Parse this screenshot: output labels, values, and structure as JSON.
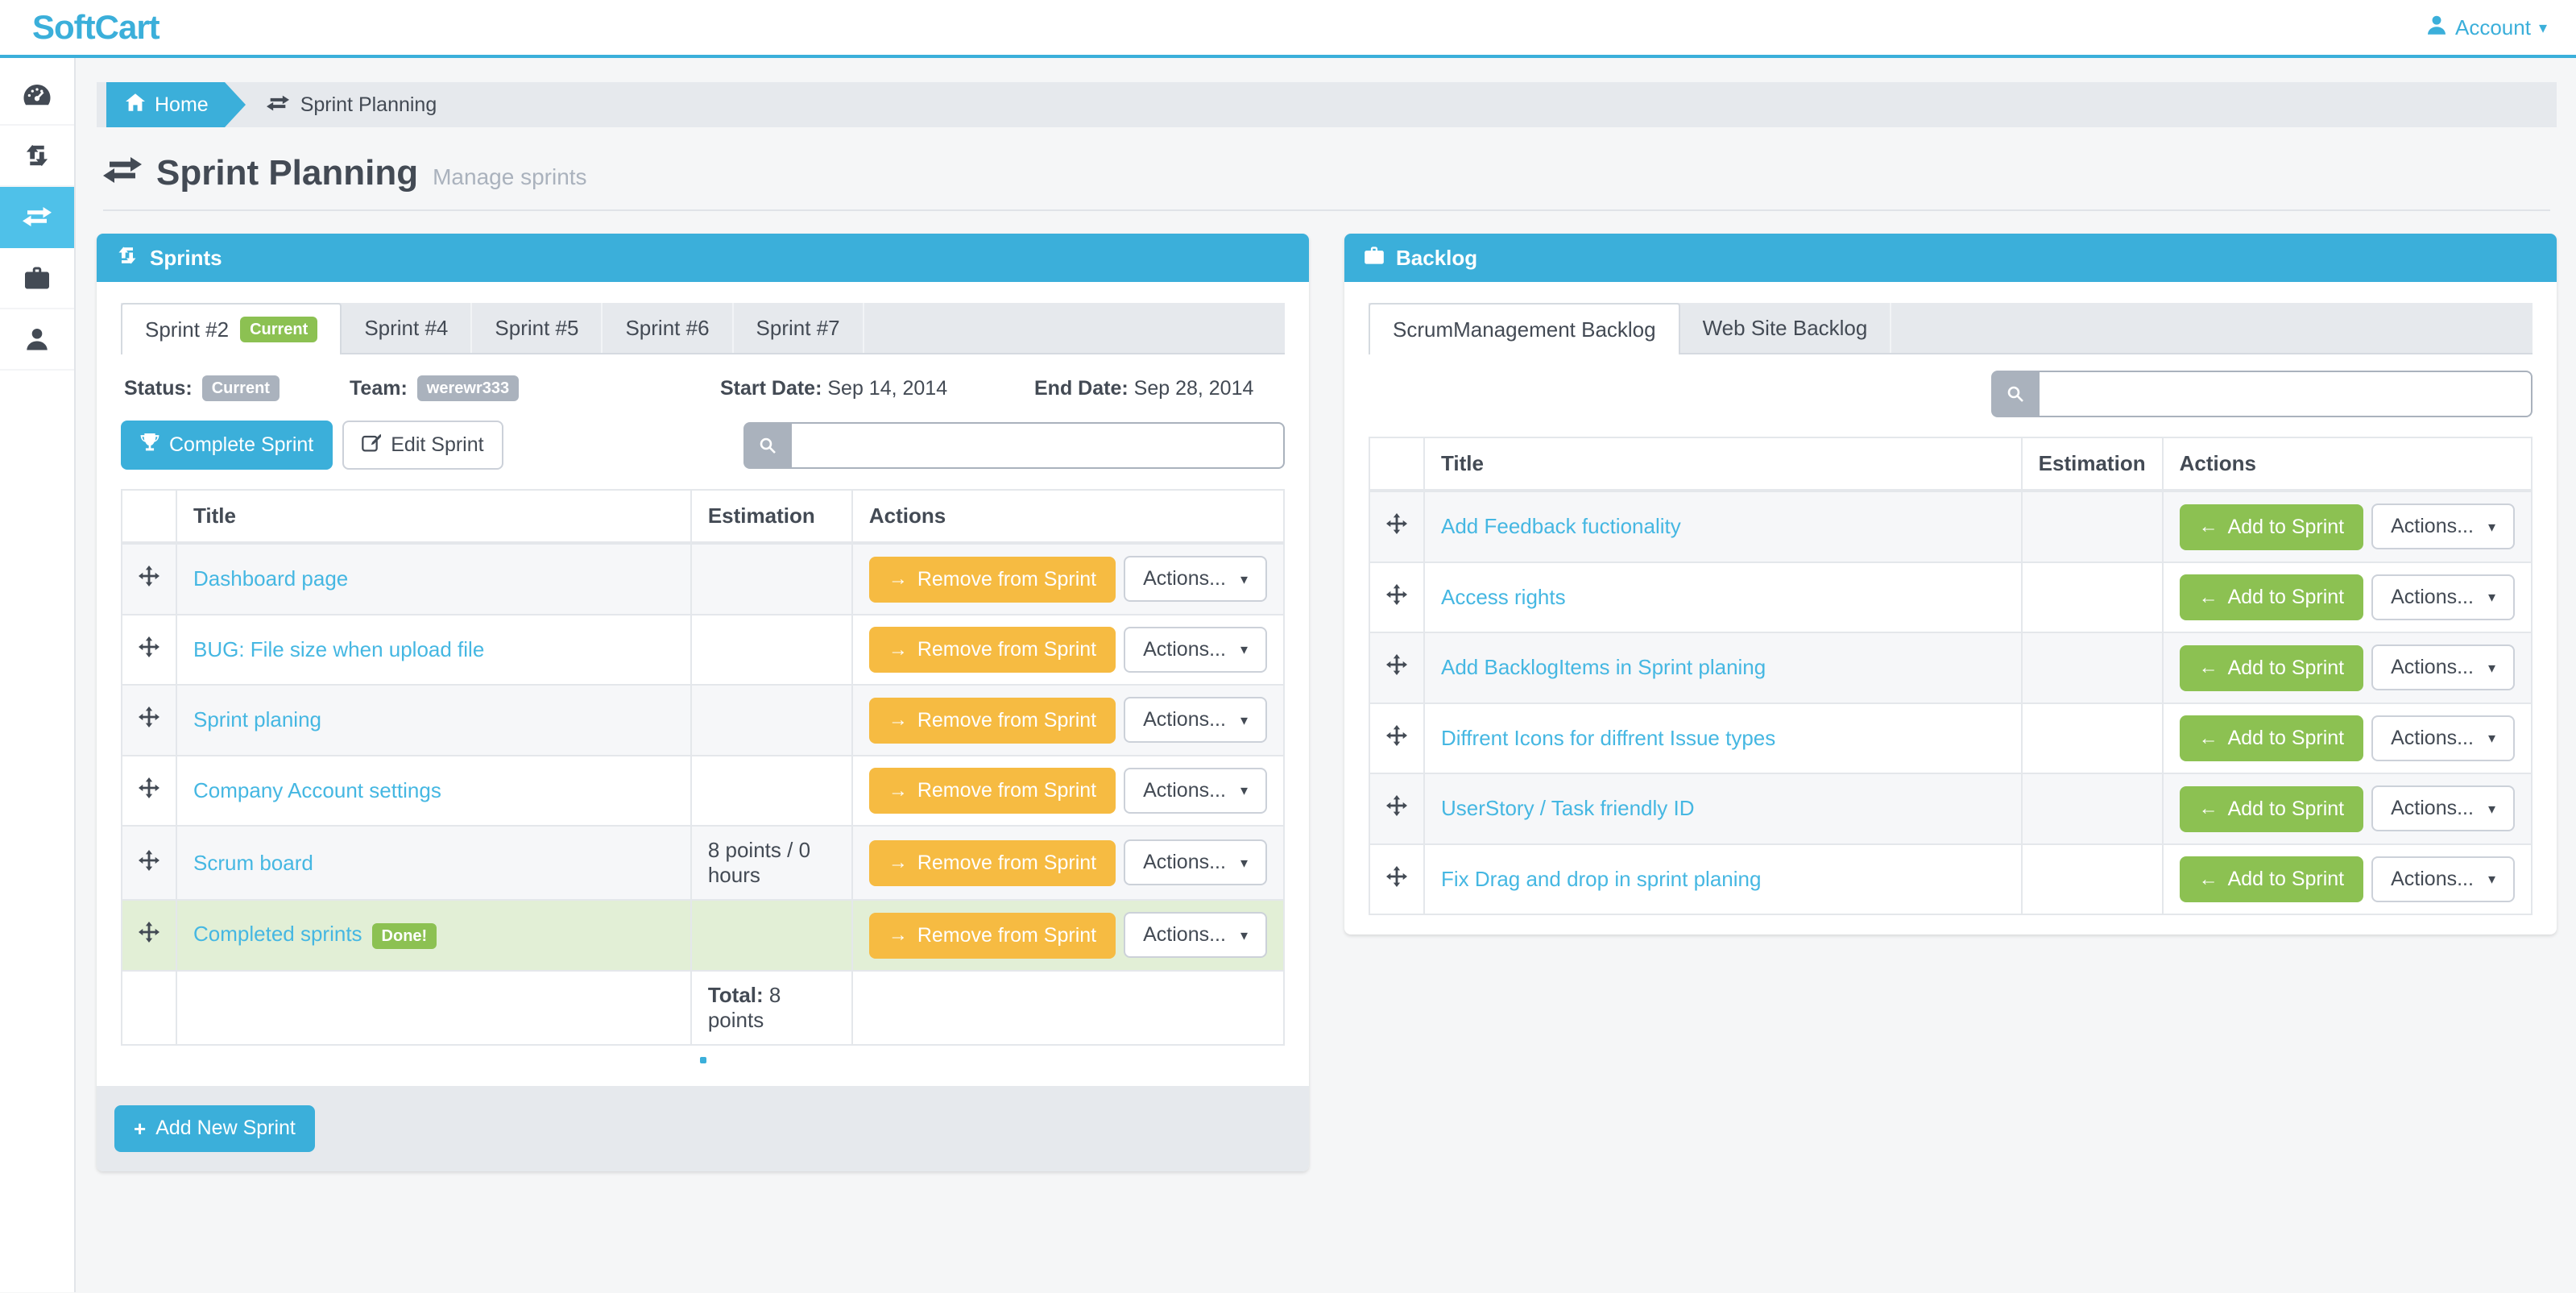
{
  "navbar": {
    "brand": "SoftCart",
    "account_label": "Account"
  },
  "sidebar": {
    "items": [
      {
        "id": "dashboard",
        "icon": "tachometer-icon",
        "active": false
      },
      {
        "id": "iterations",
        "icon": "retweet-icon",
        "active": false
      },
      {
        "id": "sprint-planning",
        "icon": "exchange-icon",
        "active": true
      },
      {
        "id": "backlog",
        "icon": "briefcase-icon",
        "active": false
      },
      {
        "id": "team",
        "icon": "user-icon",
        "active": false
      }
    ]
  },
  "breadcrumb": {
    "home": "Home",
    "current": "Sprint Planning"
  },
  "page": {
    "title": "Sprint Planning",
    "subtitle": "Manage sprints"
  },
  "sprints_panel": {
    "title": "Sprints",
    "tabs": [
      {
        "label": "Sprint #2",
        "badge": "Current",
        "active": true
      },
      {
        "label": "Sprint #4",
        "badge": null,
        "active": false
      },
      {
        "label": "Sprint #5",
        "badge": null,
        "active": false
      },
      {
        "label": "Sprint #6",
        "badge": null,
        "active": false
      },
      {
        "label": "Sprint #7",
        "badge": null,
        "active": false
      }
    ],
    "meta": {
      "status_label": "Status:",
      "status_value": "Current",
      "team_label": "Team:",
      "team_value": "werewr333",
      "start_label": "Start Date:",
      "start_value": "Sep 14, 2014",
      "end_label": "End Date:",
      "end_value": "Sep 28, 2014"
    },
    "buttons": {
      "complete": "Complete Sprint",
      "edit": "Edit Sprint"
    },
    "search_value": "",
    "table": {
      "columns": [
        "",
        "Title",
        "Estimation",
        "Actions"
      ],
      "remove_button": "Remove from Sprint",
      "actions_button": "Actions...",
      "rows": [
        {
          "title": "Dashboard page",
          "estimation": "",
          "badge": null,
          "done": false
        },
        {
          "title": "BUG: File size when upload file",
          "estimation": "",
          "badge": null,
          "done": false
        },
        {
          "title": "Sprint planing",
          "estimation": "",
          "badge": null,
          "done": false
        },
        {
          "title": "Company Account settings",
          "estimation": "",
          "badge": null,
          "done": false
        },
        {
          "title": "Scrum board",
          "estimation": "8 points / 0 hours",
          "badge": null,
          "done": false
        },
        {
          "title": "Completed sprints",
          "estimation": "",
          "badge": "Done!",
          "done": true
        }
      ],
      "total_label": "Total:",
      "total_value": "8 points"
    },
    "footer": {
      "add_button": "Add New Sprint"
    }
  },
  "backlog_panel": {
    "title": "Backlog",
    "tabs": [
      {
        "label": "ScrumManagement Backlog",
        "badge": null,
        "active": true
      },
      {
        "label": "Web Site Backlog",
        "badge": null,
        "active": false
      }
    ],
    "search_value": "",
    "table": {
      "columns": [
        "",
        "Title",
        "Estimation",
        "Actions"
      ],
      "add_button": "Add to Sprint",
      "actions_button": "Actions...",
      "rows": [
        {
          "title": "Add Feedback fuctionality"
        },
        {
          "title": "Access rights"
        },
        {
          "title": "Add BacklogItems in Sprint planing"
        },
        {
          "title": "Diffrent Icons for diffrent Issue types"
        },
        {
          "title": "UserStory / Task friendly ID"
        },
        {
          "title": "Fix Drag and drop in sprint planing"
        }
      ]
    }
  },
  "colors": {
    "accent": "#3BAFDA",
    "accent_light": "#4FC1E9",
    "link": "#45B7E2",
    "green": "#8CC152",
    "orange": "#F6BB42",
    "badge_gray": "#AAB2BD",
    "text": "#434A54",
    "bar_gray": "#E6E9ED"
  }
}
